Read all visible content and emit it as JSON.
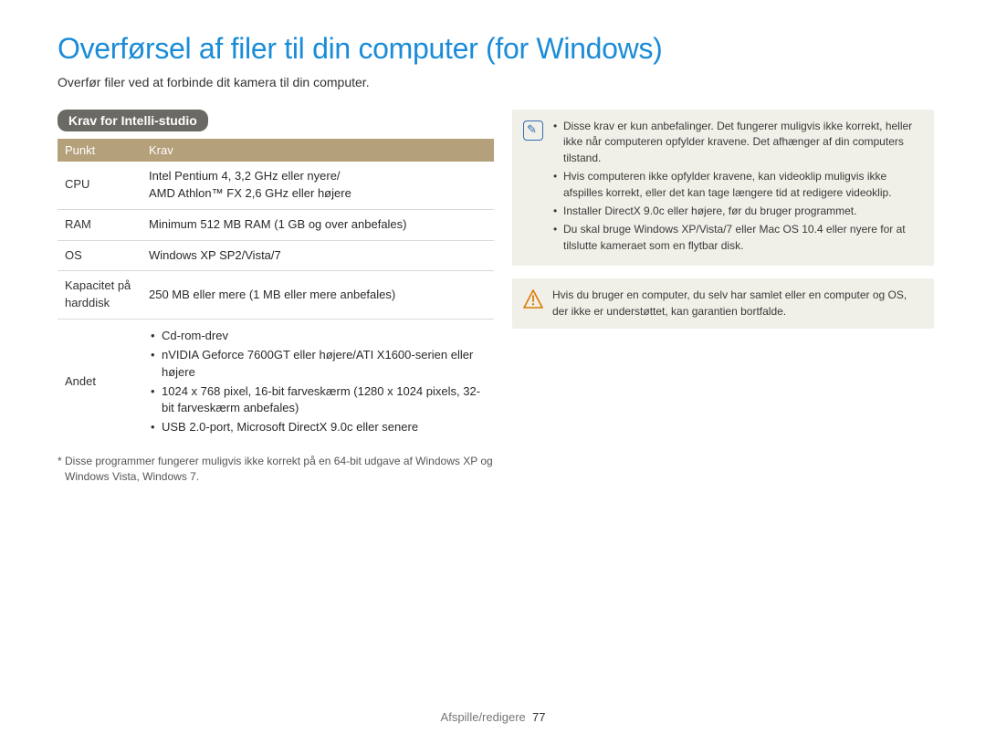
{
  "title": "Overførsel af filer til din computer (for Windows)",
  "intro": "Overfør filer ved at forbinde dit kamera til din computer.",
  "section_badge": "Krav for Intelli-studio",
  "table": {
    "headers": {
      "col1": "Punkt",
      "col2": "Krav"
    },
    "rows": {
      "cpu": {
        "label": "CPU",
        "value": "Intel Pentium 4, 3,2 GHz eller nyere/\nAMD Athlon™ FX 2,6 GHz eller højere"
      },
      "ram": {
        "label": "RAM",
        "value": "Minimum 512 MB RAM (1 GB og over anbefales)"
      },
      "os": {
        "label": "OS",
        "value": "Windows XP SP2/Vista/7"
      },
      "disk": {
        "label": "Kapacitet på harddisk",
        "value": "250 MB eller mere (1 MB eller mere anbefales)"
      },
      "other": {
        "label": "Andet",
        "items": [
          "Cd-rom-drev",
          "nVIDIA Geforce 7600GT eller højere/ATI X1600-serien eller højere",
          "1024 x 768 pixel, 16-bit farveskærm (1280 x 1024 pixels, 32-bit farveskærm anbefales)",
          "USB 2.0-port, Microsoft DirectX 9.0c eller senere"
        ]
      }
    }
  },
  "footnote": "* Disse programmer fungerer muligvis ikke korrekt på en 64-bit udgave af Windows XP og Windows Vista, Windows 7.",
  "note": {
    "items": [
      "Disse krav er kun anbefalinger. Det fungerer muligvis ikke korrekt, heller ikke når computeren opfylder kravene. Det afhænger af din computers tilstand.",
      "Hvis computeren ikke opfylder kravene, kan videoklip muligvis ikke afspilles korrekt, eller det kan tage længere tid at redigere videoklip.",
      "Installer DirectX 9.0c eller højere, før du bruger programmet.",
      "Du skal bruge Windows XP/Vista/7 eller Mac OS 10.4 eller nyere for at tilslutte kameraet som en flytbar disk."
    ]
  },
  "warning": "Hvis du bruger en computer, du selv har samlet eller en computer og OS, der ikke er understøttet, kan garantien bortfalde.",
  "footer": {
    "section": "Afspille/redigere",
    "page": "77"
  }
}
